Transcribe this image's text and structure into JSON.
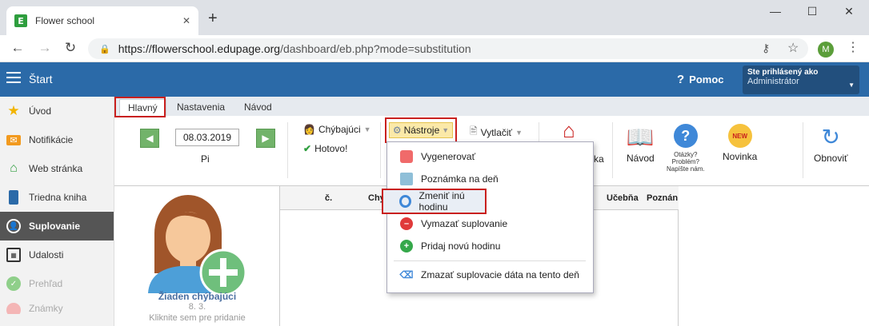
{
  "browser": {
    "tab_title": "Flower school",
    "favicon_letter": "E",
    "url_host": "https://flowerschool.edupage.org",
    "url_path": "/dashboard/eb.php?mode=substitution",
    "profile_initial": "M"
  },
  "header": {
    "start_label": "Štart",
    "help_label": "Pomoc",
    "logged_in_label": "Ste prihlásený ako",
    "role": "Administrátor"
  },
  "sidebar": {
    "items": [
      {
        "label": "Úvod"
      },
      {
        "label": "Notifikácie"
      },
      {
        "label": "Web stránka"
      },
      {
        "label": "Triedna kniha"
      },
      {
        "label": "Suplovanie"
      },
      {
        "label": "Udalosti"
      },
      {
        "label": "Prehľad"
      },
      {
        "label": "Známky"
      }
    ]
  },
  "ribbon": {
    "tabs": [
      "Hlavný",
      "Nastavenia",
      "Návod"
    ],
    "date": "08.03.2019",
    "day": "Pi",
    "absent_label": "Chýbajúci",
    "done_label": "Hotovo!",
    "tools_label": "Nástroje",
    "print_label": "Vytlačiť",
    "partial_label": "ka",
    "guide_label": "Návod",
    "question_lines": [
      "Otázky?",
      "Problém?",
      "Napíšte nám."
    ],
    "news_label": "Novinka",
    "news_badge": "NEW",
    "refresh_label": "Obnoviť"
  },
  "dropdown": {
    "items": [
      "Vygenerovať",
      "Poznámka na deň",
      "Zmeniť inú hodinu",
      "Vymazať suplovanie",
      "Pridaj novú hodinu",
      "Zmazať suplovacie dáta na tento deň"
    ]
  },
  "left_panel": {
    "none_absent": "Žiaden chýbajúci",
    "date_short": "8. 3.",
    "hint": "Kliknite sem pre pridanie"
  },
  "table": {
    "headers": [
      "č.",
      "Chy",
      "Učebňa",
      "Poznán"
    ]
  },
  "colors": {
    "appbar": "#2b6aa8",
    "highlight_red": "#c9201e",
    "arrow_green": "#72b36a"
  }
}
